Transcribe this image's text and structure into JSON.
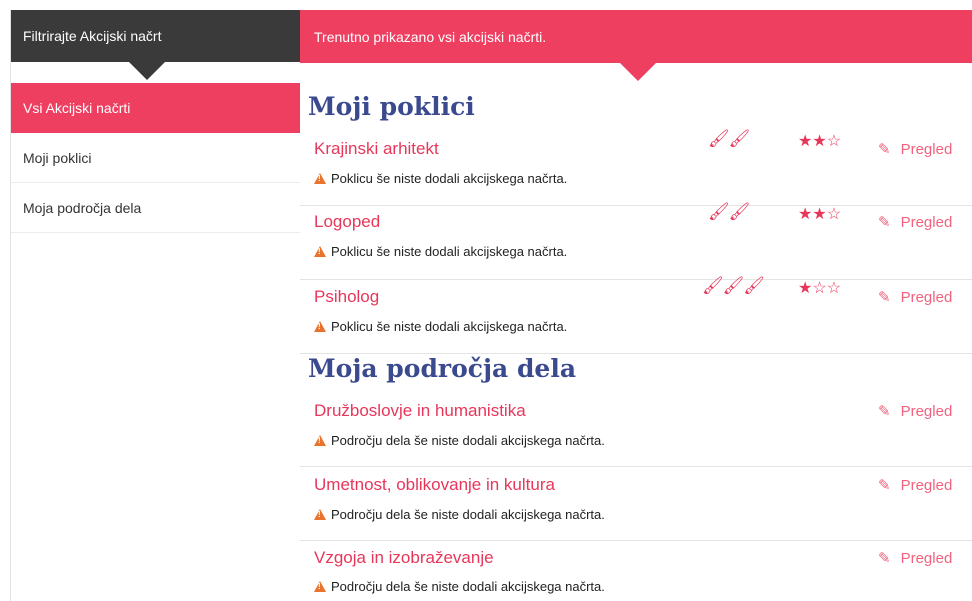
{
  "sidebar": {
    "header": "Filtrirajte Akcijski načrt",
    "items": [
      {
        "label": "Vsi Akcijski načrti",
        "active": true
      },
      {
        "label": "Moji poklici",
        "active": false
      },
      {
        "label": "Moja področja dela",
        "active": false
      }
    ]
  },
  "main": {
    "header": "Trenutno prikazano vsi akcijski načrti.",
    "sections": [
      {
        "title": "Moji poklici",
        "rows": [
          {
            "title": "Krajinski arhitekt",
            "warning": "Poklicu še niste dodali akcijskega načrta.",
            "brushes": 2,
            "stars": 2,
            "stars_max": 3,
            "action": "Pregled"
          },
          {
            "title": "Logoped",
            "warning": "Poklicu še niste dodali akcijskega načrta.",
            "brushes": 2,
            "stars": 2,
            "stars_max": 3,
            "action": "Pregled"
          },
          {
            "title": "Psiholog",
            "warning": "Poklicu še niste dodali akcijskega načrta.",
            "brushes": 3,
            "stars": 1,
            "stars_max": 3,
            "action": "Pregled"
          }
        ]
      },
      {
        "title": "Moja področja dela",
        "rows": [
          {
            "title": "Družboslovje in humanistika",
            "warning": "Področju dela še niste dodali akcijskega načrta.",
            "action": "Pregled"
          },
          {
            "title": "Umetnost, oblikovanje in kultura",
            "warning": "Področju dela še niste dodali akcijskega načrta.",
            "action": "Pregled"
          },
          {
            "title": "Vzgoja in izobraževanje",
            "warning": "Področju dela še niste dodali akcijskega načrta.",
            "action": "Pregled"
          }
        ]
      }
    ]
  },
  "colors": {
    "accent": "#ee3f61",
    "dark": "#3a3a3a",
    "section_title": "#3b4a8e",
    "warning": "#e8732c"
  }
}
